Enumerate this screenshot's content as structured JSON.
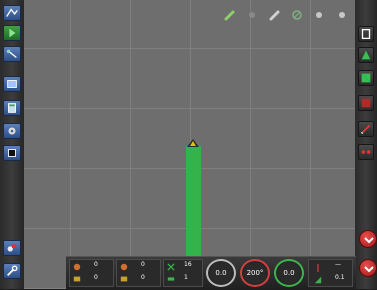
{
  "colors": {
    "map_background": "#6e6e6e",
    "coverage_path": "#34b34a",
    "left_button": "#3d629e",
    "alert_red": "#c82a2a"
  },
  "left_toolbar": {
    "buttons": [
      {
        "icon": "map-view-icon"
      },
      {
        "icon": "guidance-play-icon"
      },
      {
        "icon": "tractor-line-icon"
      },
      {
        "icon": "screen-layout-icon"
      },
      {
        "icon": "calculator-icon"
      },
      {
        "icon": "settings-gear-icon"
      },
      {
        "icon": "record-stop-icon"
      },
      {
        "icon": "vehicle-config-icon"
      },
      {
        "icon": "wrench-icon"
      }
    ]
  },
  "right_toolbar": {
    "buttons": [
      {
        "icon": "field-boundary-icon"
      },
      {
        "icon": "green-marker-icon"
      },
      {
        "icon": "green-flag-icon"
      },
      {
        "icon": "red-square-icon"
      },
      {
        "icon": "pen-draw-icon"
      },
      {
        "icon": "lightbar-icon"
      }
    ],
    "alerts": [
      {
        "icon": "zoom-out-red-icon"
      },
      {
        "icon": "nudge-down-red-icon"
      }
    ]
  },
  "map_toolbar": {
    "icons": [
      "pencil-green-icon",
      "dot-grey-icon",
      "pencil-grey-icon",
      "satellite-icon",
      "dot-grey-icon-2",
      "dot-grey-icon-3"
    ]
  },
  "status_bar": {
    "cells": [
      {
        "label_top": "0",
        "label_bottom": "0"
      },
      {
        "label_top": "0",
        "label_bottom": "0"
      },
      {
        "label_top": "16",
        "label_bottom": "1"
      }
    ],
    "gauges": [
      {
        "value": "0.0"
      },
      {
        "value": "200°"
      },
      {
        "value": "0.0"
      }
    ],
    "right_cell": {
      "top": "—",
      "bottom": "0.1"
    }
  }
}
